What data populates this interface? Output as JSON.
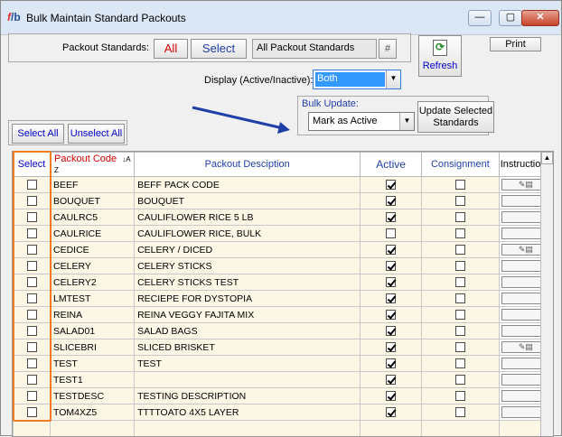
{
  "window": {
    "title": "Bulk Maintain Standard Packouts",
    "icon_f": "f",
    "icon_b": "/b",
    "minimize": "—",
    "maximize": "▢",
    "close": "✕"
  },
  "filters": {
    "packout_standards_label": "Packout Standards:",
    "all_label": "All",
    "select_label": "Select",
    "standards_value": "All Packout Standards",
    "hash_label": "#",
    "display_label": "Display (Active/Inactive):",
    "display_value": "Both",
    "refresh_label": "Refresh",
    "print_label": "Print"
  },
  "bulk": {
    "label": "Bulk Update:",
    "action_value": "Mark as Active",
    "update_label_1": "Update Selected",
    "update_label_2": "Standards"
  },
  "selection": {
    "select_all": "Select All",
    "unselect_all": "Unselect All"
  },
  "table": {
    "headers": {
      "select": "Select",
      "code": "Packout Code",
      "sort_icon": "↓A Z",
      "description": "Packout Desciption",
      "active": "Active",
      "consignment": "Consignment",
      "instructions": "Instructions"
    },
    "rows": [
      {
        "code": "BEEF",
        "desc": "BEFF PACK CODE",
        "active": true,
        "consignment": false,
        "instr": true
      },
      {
        "code": "BOUQUET",
        "desc": "BOUQUET",
        "active": true,
        "consignment": false,
        "instr": false
      },
      {
        "code": "CAULRC5",
        "desc": "CAULIFLOWER RICE 5 LB",
        "active": true,
        "consignment": false,
        "instr": false
      },
      {
        "code": "CAULRICE",
        "desc": "CAULIFLOWER RICE, BULK",
        "active": false,
        "consignment": false,
        "instr": false
      },
      {
        "code": "CEDICE",
        "desc": "CELERY / DICED",
        "active": true,
        "consignment": false,
        "instr": true
      },
      {
        "code": "CELERY",
        "desc": "CELERY STICKS",
        "active": true,
        "consignment": false,
        "instr": false
      },
      {
        "code": "CELERY2",
        "desc": "CELERY STICKS TEST",
        "active": true,
        "consignment": false,
        "instr": false
      },
      {
        "code": "LMTEST",
        "desc": "RECIEPE FOR DYSTOPIA",
        "active": true,
        "consignment": false,
        "instr": false
      },
      {
        "code": "REINA",
        "desc": "REINA VEGGY FAJITA MIX",
        "active": true,
        "consignment": false,
        "instr": false
      },
      {
        "code": "SALAD01",
        "desc": "SALAD BAGS",
        "active": true,
        "consignment": false,
        "instr": false
      },
      {
        "code": "SLICEBRI",
        "desc": "SLICED BRISKET",
        "active": true,
        "consignment": false,
        "instr": true
      },
      {
        "code": "TEST",
        "desc": "TEST",
        "active": true,
        "consignment": false,
        "instr": false
      },
      {
        "code": "TEST1",
        "desc": "",
        "active": true,
        "consignment": false,
        "instr": false
      },
      {
        "code": "TESTDESC",
        "desc": "TESTING DESCRIPTION",
        "active": true,
        "consignment": false,
        "instr": false
      },
      {
        "code": "TOM4XZ5",
        "desc": "TTTTOATO 4X5 LAYER",
        "active": true,
        "consignment": false,
        "instr": false
      }
    ]
  },
  "colors": {
    "accent_red": "#d40000",
    "accent_blue": "#0000cc",
    "highlight_orange": "#ef7b22",
    "arrow_blue": "#1f3fa6",
    "selection_blue": "#3399ff"
  }
}
